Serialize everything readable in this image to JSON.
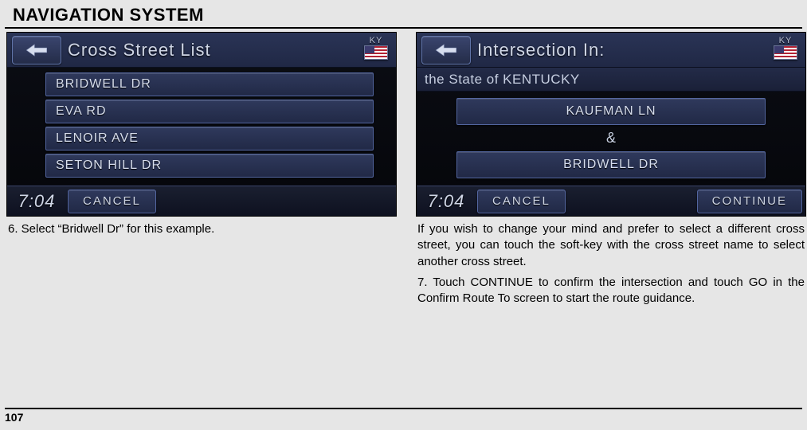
{
  "page": {
    "title": "NAVIGATION SYSTEM",
    "number": "107"
  },
  "left": {
    "header_title": "Cross Street List",
    "state_abbr": "KY",
    "items": [
      "BRIDWELL DR",
      "EVA RD",
      "LENOIR AVE",
      "SETON HILL DR"
    ],
    "clock": "7:04",
    "cancel_label": "CANCEL",
    "caption": "6. Select “Bridwell Dr” for this example."
  },
  "right": {
    "header_title": "Intersection In:",
    "state_abbr": "KY",
    "subheader": "the State of KENTUCKY",
    "street1": "KAUFMAN LN",
    "amp": "&",
    "street2": "BRIDWELL DR",
    "clock": "7:04",
    "cancel_label": "CANCEL",
    "continue_label": "CONTINUE",
    "caption_p1": "If you wish to change your mind and prefer to select a different cross street, you can touch the soft-key with the cross street name to select another cross street.",
    "caption_p2": "7. Touch CONTINUE to confirm the intersection and touch GO in the Confirm Route To screen to start the route guidance."
  }
}
